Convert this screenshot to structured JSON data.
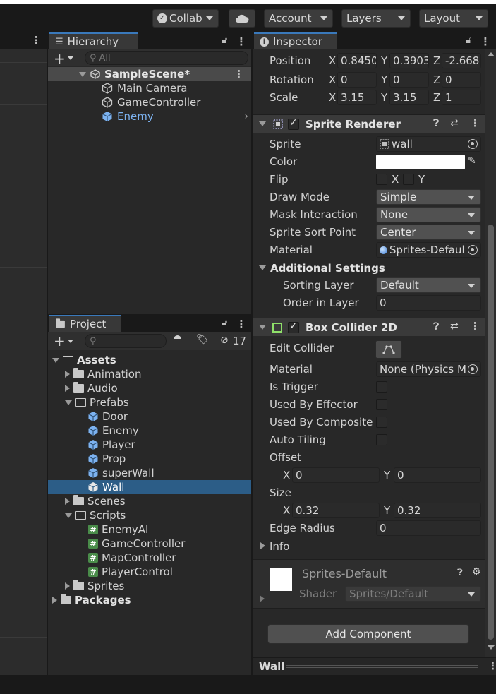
{
  "toolbar": {
    "collab": "Collab",
    "account": "Account",
    "layers": "Layers",
    "layout": "Layout"
  },
  "hierarchy": {
    "tab": "Hierarchy",
    "search_placeholder": "All",
    "scene": "SampleScene*",
    "items": [
      "Main Camera",
      "GameController",
      "Enemy"
    ]
  },
  "project": {
    "tab": "Project",
    "hidden_count": "17",
    "tree": {
      "assets": "Assets",
      "animation": "Animation",
      "audio": "Audio",
      "prefabs": "Prefabs",
      "prefab_items": [
        "Door",
        "Enemy",
        "Player",
        "Prop",
        "superWall",
        "Wall"
      ],
      "scenes": "Scenes",
      "scripts": "Scripts",
      "script_items": [
        "EnemyAI",
        "GameController",
        "MapController",
        "PlayerControl"
      ],
      "sprites": "Sprites",
      "packages": "Packages"
    }
  },
  "inspector": {
    "tab": "Inspector",
    "transform": {
      "position_label": "Position",
      "rotation_label": "Rotation",
      "scale_label": "Scale",
      "axis_x": "X",
      "axis_y": "Y",
      "axis_z": "Z",
      "position": [
        "0.8450",
        "0.3903",
        "-2.668"
      ],
      "rotation": [
        "0",
        "0",
        "0"
      ],
      "scale": [
        "3.15",
        "3.15",
        "1"
      ]
    },
    "sprite_renderer": {
      "title": "Sprite Renderer",
      "sprite_label": "Sprite",
      "sprite_value": "wall",
      "color_label": "Color",
      "color_value": "#ffffff",
      "flip_label": "Flip",
      "flip_x": "X",
      "flip_y": "Y",
      "draw_mode_label": "Draw Mode",
      "draw_mode_value": "Simple",
      "mask_label": "Mask Interaction",
      "mask_value": "None",
      "sort_point_label": "Sprite Sort Point",
      "sort_point_value": "Center",
      "material_label": "Material",
      "material_value": "Sprites-Defaul",
      "additional_title": "Additional Settings",
      "sorting_layer_label": "Sorting Layer",
      "sorting_layer_value": "Default",
      "order_label": "Order in Layer",
      "order_value": "0"
    },
    "box_collider": {
      "title": "Box Collider 2D",
      "edit_label": "Edit Collider",
      "material_label": "Material",
      "material_value": "None (Physics M",
      "is_trigger_label": "Is Trigger",
      "effector_label": "Used By Effector",
      "composite_label": "Used By Composite",
      "auto_tiling_label": "Auto Tiling",
      "offset_label": "Offset",
      "offset_x": "0",
      "offset_y": "0",
      "size_label": "Size",
      "size_x": "0.32",
      "size_y": "0.32",
      "edge_radius_label": "Edge Radius",
      "edge_radius_value": "0",
      "info_label": "Info"
    },
    "material_preview": {
      "name": "Sprites-Default",
      "shader_label": "Shader",
      "shader_value": "Sprites/Default"
    },
    "add_component": "Add Component",
    "footer_label": "Wall"
  },
  "colors": {
    "selection": "#2c5d87",
    "accent_tab": "#3a79bb",
    "highlight_text": "#7cb2f0"
  }
}
